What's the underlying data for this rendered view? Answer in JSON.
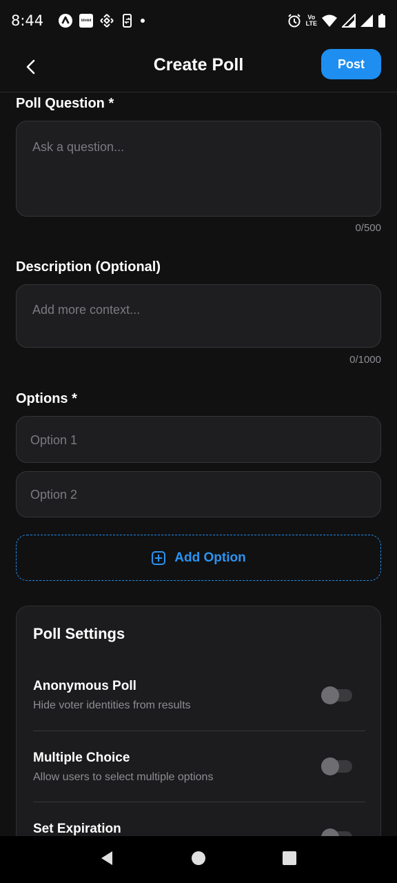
{
  "status_bar": {
    "time": "8:44",
    "box_icon_text": "blinkit",
    "volte_top": "Vo",
    "volte_bottom": "LTE"
  },
  "header": {
    "title": "Create Poll",
    "post_label": "Post"
  },
  "poll_question": {
    "label": "Poll Question *",
    "placeholder": "Ask a question...",
    "counter": "0/500"
  },
  "description": {
    "label": "Description (Optional)",
    "placeholder": "Add more context...",
    "counter": "0/1000"
  },
  "options": {
    "label": "Options *",
    "items": [
      {
        "placeholder": "Option 1"
      },
      {
        "placeholder": "Option 2"
      }
    ],
    "add_label": "Add Option"
  },
  "settings": {
    "title": "Poll Settings",
    "rows": [
      {
        "title": "Anonymous Poll",
        "desc": "Hide voter identities from results",
        "enabled": false
      },
      {
        "title": "Multiple Choice",
        "desc": "Allow users to select multiple options",
        "enabled": false
      },
      {
        "title": "Set Expiration",
        "desc": "",
        "enabled": false
      }
    ]
  },
  "colors": {
    "accent": "#1e8ff0",
    "background": "#111112",
    "field": "#1e1e20"
  }
}
